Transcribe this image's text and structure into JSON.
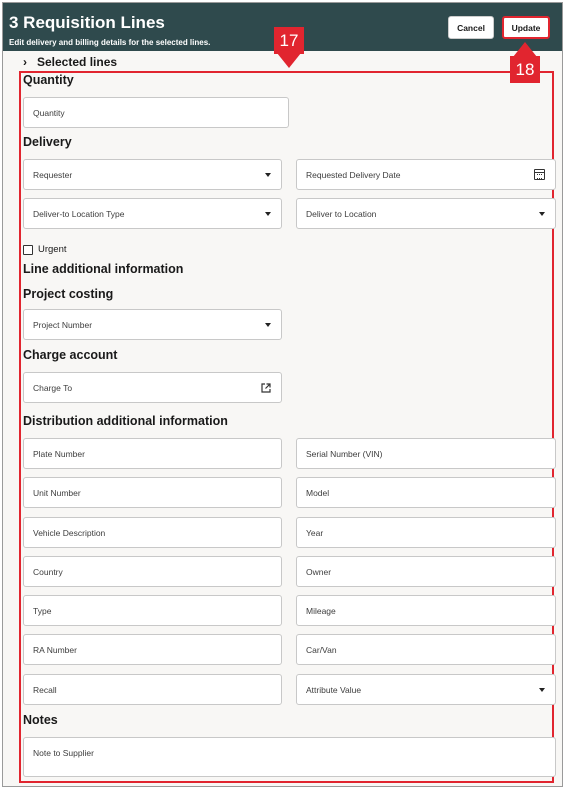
{
  "header": {
    "title": "3 Requisition Lines",
    "subtitle": "Edit delivery and billing details for the selected lines.",
    "cancel_label": "Cancel",
    "update_label": "Update"
  },
  "callouts": {
    "c17": "17",
    "c18": "18"
  },
  "selected_lines": {
    "label": "Selected lines"
  },
  "sections": {
    "quantity": "Quantity",
    "delivery": "Delivery",
    "line_additional": "Line additional information",
    "project_costing": "Project costing",
    "charge_account": "Charge account",
    "distribution": "Distribution additional information",
    "notes": "Notes"
  },
  "fields": {
    "quantity": "Quantity",
    "requester": "Requester",
    "requested_delivery_date": "Requested Delivery Date",
    "deliver_to_location_type": "Deliver-to Location Type",
    "deliver_to_location": "Deliver to Location",
    "urgent": "Urgent",
    "project_number": "Project Number",
    "charge_to": "Charge To",
    "plate_number": "Plate Number",
    "serial_number": "Serial Number (VIN)",
    "unit_number": "Unit Number",
    "model": "Model",
    "vehicle_description": "Vehicle Description",
    "year": "Year",
    "country": "Country",
    "owner": "Owner",
    "type": "Type",
    "mileage": "Mileage",
    "ra_number": "RA Number",
    "car_van": "Car/Van",
    "recall": "Recall",
    "attribute_value": "Attribute Value",
    "note_to_supplier": "Note to Supplier"
  },
  "colors": {
    "header_bg": "#2f4a4d",
    "callout_red": "#e1252f",
    "panel_bg": "#f8f7f5"
  }
}
